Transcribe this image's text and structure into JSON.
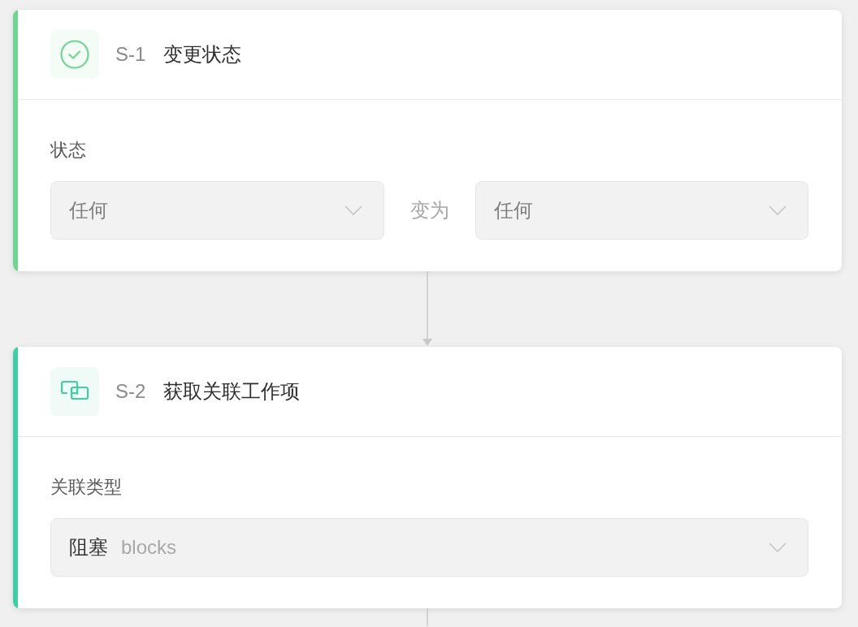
{
  "steps": [
    {
      "kind": "status_change",
      "code": "S-1",
      "title": "变更状态",
      "color": "#6fd692",
      "label": "状态",
      "selects": [
        {
          "value": "任何",
          "muted": true
        },
        {
          "value": "任何",
          "muted": true
        }
      ],
      "separator": "变为"
    },
    {
      "kind": "linked_items",
      "code": "S-2",
      "title": "获取关联工作项",
      "color": "#3ccfa5",
      "label": "关联类型",
      "selects": [
        {
          "value": "阻塞",
          "note": "blocks",
          "muted": false
        }
      ]
    }
  ]
}
